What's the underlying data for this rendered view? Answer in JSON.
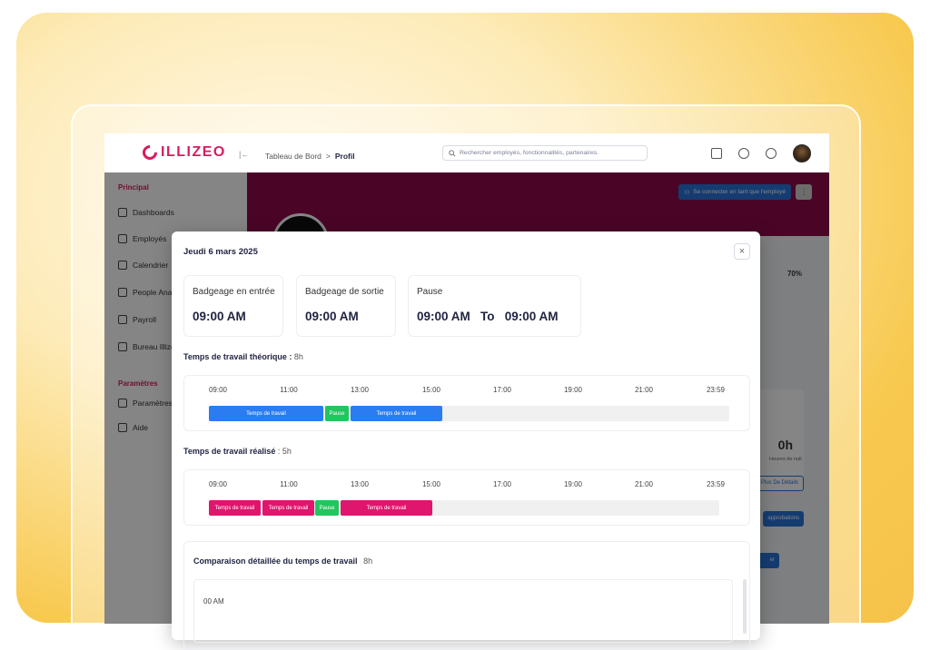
{
  "brand": {
    "name": "ILLIZEO",
    "color": "#d81b60"
  },
  "header": {
    "breadcrumb": [
      "Tableau de Bord",
      ">",
      "Profil"
    ],
    "search_placeholder": "Rechercher employés, fonctionnalités, partenaires."
  },
  "sidebar": {
    "section_main": "Principal",
    "items": [
      "Dashboards",
      "Employés",
      "Calendrier",
      "People Anal",
      "Payroll",
      "Bureau Illize"
    ],
    "section_settings": "Paramètres",
    "settings_items": [
      "Paramètres",
      "Aide"
    ]
  },
  "profile": {
    "connect_button": "Se connecter en tant que l'employé",
    "progress_text": "70%",
    "hours_value": "0h",
    "hours_label": "Heures de nuit",
    "details_button": "Plus De Détails",
    "approvals_button": "approbations",
    "partial_button": "er",
    "colors": {
      "band": "#8e0b4a",
      "primary": "#2a74d8"
    }
  },
  "modal": {
    "date": "Jeudi 6 mars 2025",
    "close_icon": "close-icon",
    "cards": [
      {
        "label": "Badgeage en entrée",
        "value": "09:00 AM"
      },
      {
        "label": "Badgeage de sortie",
        "value": "09:00 AM"
      },
      {
        "label": "Pause",
        "value": "09:00 AM   To   09:00 AM"
      }
    ],
    "theoretical": {
      "title": "Temps de travail théorique :",
      "total": "8h",
      "ticks": [
        "09:00",
        "11:00",
        "13:00",
        "15:00",
        "17:00",
        "19:00",
        "21:00",
        "23:59"
      ],
      "segments": [
        {
          "label": "Temps de travail",
          "type": "work",
          "color": "#2a7cf0"
        },
        {
          "label": "Pause",
          "type": "pause",
          "color": "#22c55e"
        },
        {
          "label": "Temps de travail",
          "type": "work",
          "color": "#2a7cf0"
        }
      ]
    },
    "actual": {
      "title": "Temps de travail réalisé",
      "total": ": 5h",
      "ticks": [
        "09:00",
        "11:00",
        "13:00",
        "15:00",
        "17:00",
        "19:00",
        "21:00",
        "23:59"
      ],
      "segments": [
        {
          "label": "Temps de travail",
          "type": "work",
          "color": "#e0156d"
        },
        {
          "label": "Temps de travail",
          "type": "work",
          "color": "#e0156d"
        },
        {
          "label": "Pause",
          "type": "pause",
          "color": "#22c55e"
        },
        {
          "label": "Temps de travail",
          "type": "work",
          "color": "#e0156d"
        }
      ]
    },
    "comparison": {
      "title": "Comparaison détaillée du temps de travail",
      "total": "8h",
      "first_row_label": "00 AM"
    }
  }
}
